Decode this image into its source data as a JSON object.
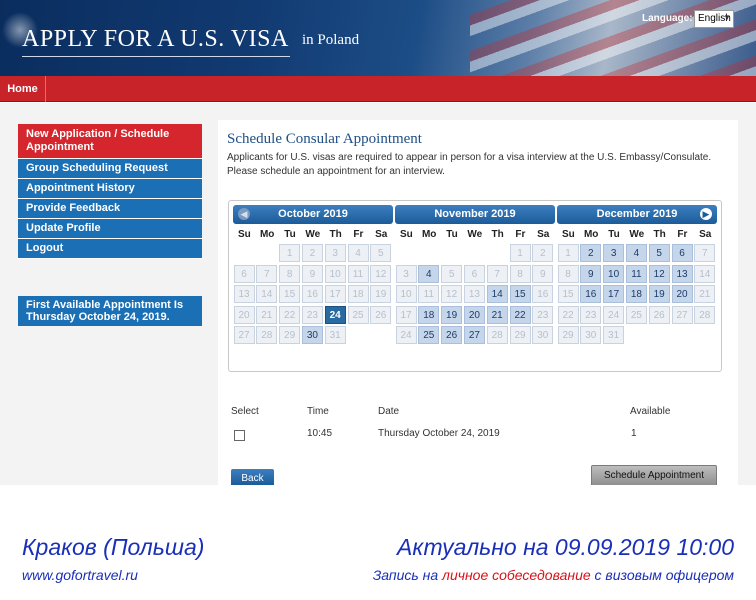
{
  "header": {
    "title": "APPLY FOR A U.S. VISA",
    "country": "in Poland",
    "language_label": "Language:",
    "language_value": "English"
  },
  "nav": {
    "home": "Home"
  },
  "sidebar": {
    "items": [
      {
        "label": "New Application / Schedule Appointment",
        "active": true
      },
      {
        "label": "Group Scheduling Request",
        "active": false
      },
      {
        "label": "Appointment History",
        "active": false
      },
      {
        "label": "Provide Feedback",
        "active": false
      },
      {
        "label": "Update Profile",
        "active": false
      },
      {
        "label": "Logout",
        "active": false
      }
    ],
    "first_available": "First Available Appointment Is Thursday October 24, 2019."
  },
  "main": {
    "title": "Schedule Consular Appointment",
    "description": "Applicants for U.S. visas are required to appear in person for a visa interview at the U.S. Embassy/Consulate. Please schedule an appointment for an interview."
  },
  "calendar": {
    "weekdays": [
      "Su",
      "Mo",
      "Tu",
      "We",
      "Th",
      "Fr",
      "Sa"
    ],
    "prev_icon": "chevron-left-icon",
    "next_icon": "chevron-right-icon",
    "selected": {
      "month": 0,
      "day": 24
    },
    "months": [
      {
        "name": "October 2019",
        "first_weekday": 2,
        "days": 31,
        "available": [
          30
        ]
      },
      {
        "name": "November 2019",
        "first_weekday": 5,
        "days": 30,
        "available": [
          4,
          14,
          15,
          18,
          19,
          20,
          21,
          22,
          25,
          26,
          27
        ]
      },
      {
        "name": "December 2019",
        "first_weekday": 0,
        "days": 31,
        "available": [
          2,
          3,
          4,
          5,
          6,
          9,
          10,
          11,
          12,
          13,
          16,
          17,
          18,
          19,
          20
        ]
      }
    ]
  },
  "table": {
    "headers": {
      "select": "Select",
      "time": "Time",
      "date": "Date",
      "available": "Available"
    },
    "rows": [
      {
        "time": "10:45",
        "date": "Thursday October 24, 2019",
        "available": "1"
      }
    ]
  },
  "buttons": {
    "back": "Back",
    "schedule": "Schedule Appointment"
  },
  "promo": {
    "city": "Краков (Польша)",
    "date": "Актуально на 09.09.2019 10:00",
    "site": "www.gofortravel.ru",
    "note_prefix": "Запись на ",
    "note_highlight": "личное собеседование",
    "note_suffix": " с визовым офицером"
  },
  "colors": {
    "accent_blue": "#1b6fb5",
    "accent_red": "#c9232a",
    "promo_blue": "#1a2fb8",
    "promo_red": "#d8131b"
  }
}
